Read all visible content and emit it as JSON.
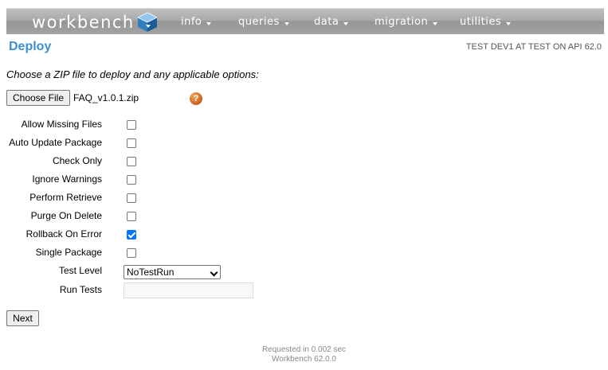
{
  "app": {
    "logo_text": "workbench",
    "menu": [
      {
        "label": "info"
      },
      {
        "label": "queries"
      },
      {
        "label": "data"
      },
      {
        "label": "migration"
      },
      {
        "label": "utilities"
      }
    ]
  },
  "page": {
    "title": "Deploy",
    "env_info": "TEST DEV1 AT TEST ON API 62.0",
    "instructions": "Choose a ZIP file to deploy and any applicable options:"
  },
  "file": {
    "button_label": "Choose File",
    "selected_file": "FAQ_v1.0.1.zip",
    "help_glyph": "?"
  },
  "options": [
    {
      "label": "Allow Missing Files",
      "checked": false
    },
    {
      "label": "Auto Update Package",
      "checked": false
    },
    {
      "label": "Check Only",
      "checked": false
    },
    {
      "label": "Ignore Warnings",
      "checked": false
    },
    {
      "label": "Perform Retrieve",
      "checked": false
    },
    {
      "label": "Purge On Delete",
      "checked": false
    },
    {
      "label": "Rollback On Error",
      "checked": true
    },
    {
      "label": "Single Package",
      "checked": false
    }
  ],
  "test_level": {
    "label": "Test Level",
    "selected": "NoTestRun"
  },
  "run_tests": {
    "label": "Run Tests",
    "value": ""
  },
  "actions": {
    "next_label": "Next"
  },
  "footer": {
    "timing": "Requested in 0.002 sec",
    "version": "Workbench 62.0.0"
  },
  "colors": {
    "title_blue": "#3d8fd1",
    "checkbox_blue": "#0075ff",
    "help_orange": "#c8621d"
  }
}
